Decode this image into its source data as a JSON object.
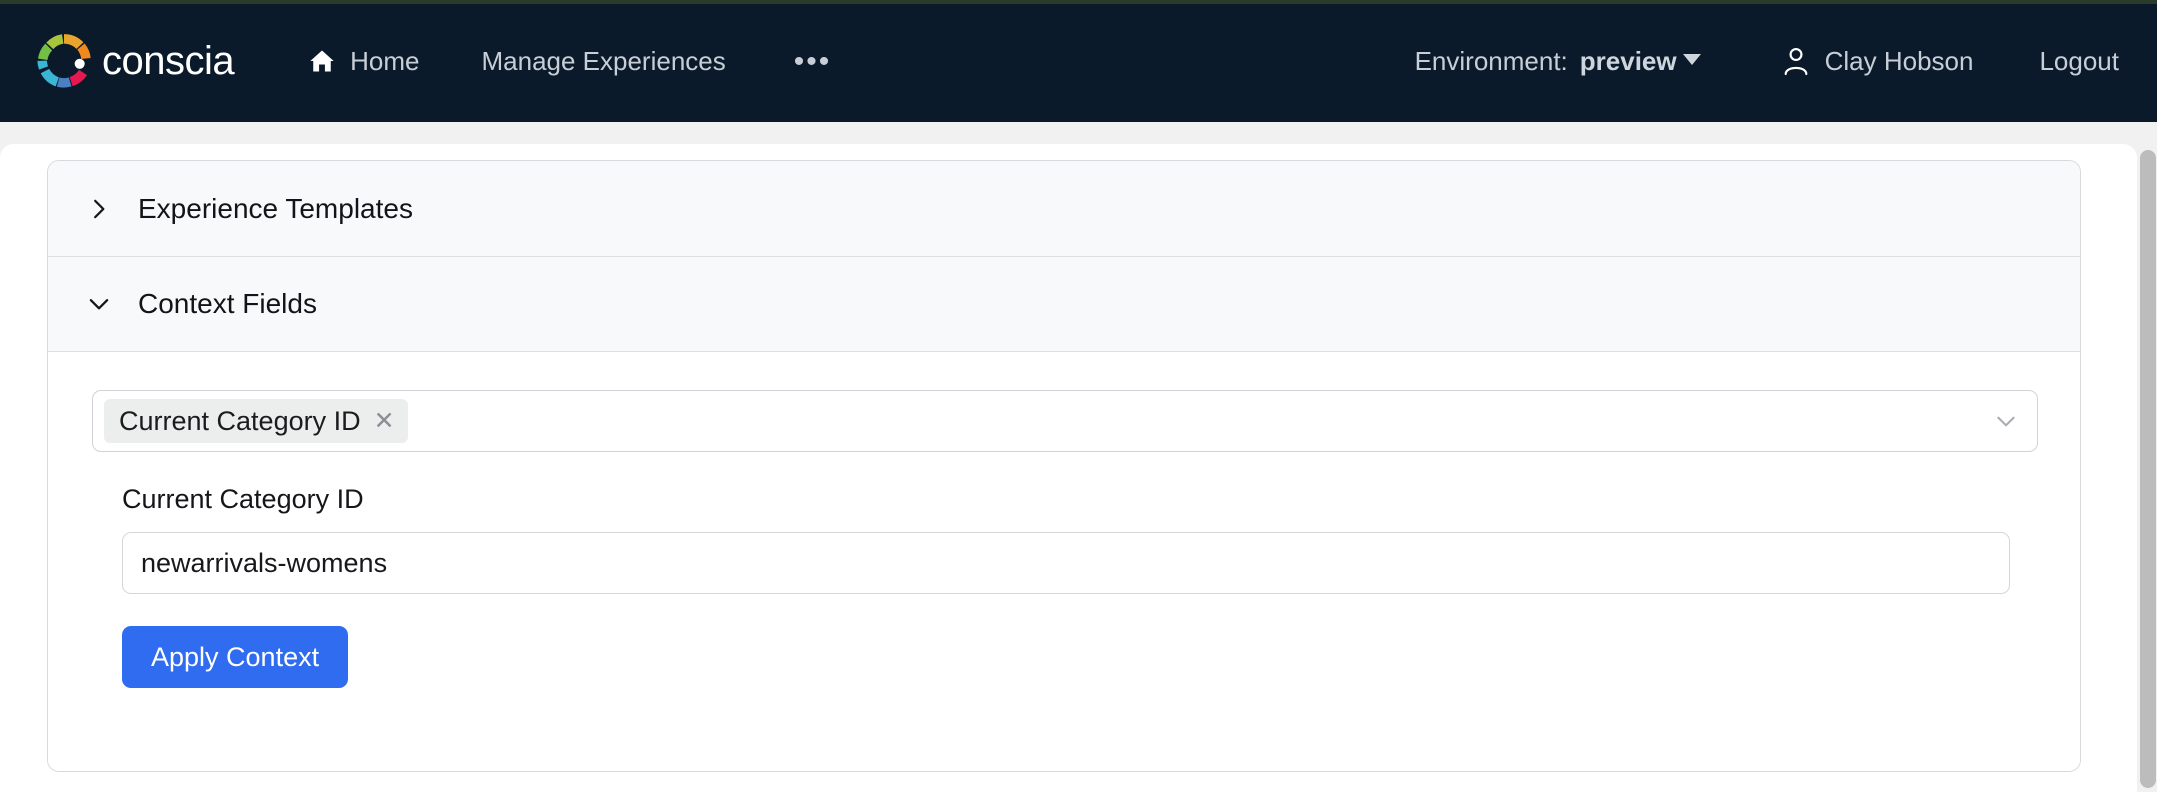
{
  "brand": {
    "name": "conscia",
    "logo_icon": "conscia-color-wheel-logo",
    "segment_colors": [
      "#f08a1e",
      "#eaa62c",
      "#a8c63c",
      "#72bf44",
      "#3ab6d4",
      "#4a7fc1",
      "#e8174f"
    ]
  },
  "nav": {
    "items": [
      {
        "label": "Home",
        "icon": "home-icon"
      },
      {
        "label": "Manage Experiences",
        "icon": null
      }
    ],
    "more_label": "•••"
  },
  "environment": {
    "label": "Environment:",
    "value": "preview",
    "caret_icon": "caret-down-icon"
  },
  "user": {
    "name": "Clay Hobson",
    "icon": "user-icon",
    "logout_label": "Logout"
  },
  "accordions": [
    {
      "title": "Experience Templates",
      "expanded": false,
      "chevron_icon": "chevron-right-icon"
    },
    {
      "title": "Context Fields",
      "expanded": true,
      "chevron_icon": "chevron-down-icon"
    }
  ],
  "context_fields": {
    "multiselect": {
      "selected_chip": "Current Category ID",
      "remove_icon": "close-x-icon",
      "dropdown_icon": "chevron-down-icon",
      "placeholder": ""
    },
    "field": {
      "label": "Current Category ID",
      "value": "newarrivals-womens",
      "placeholder": ""
    },
    "apply_button": "Apply Context"
  },
  "colors": {
    "topbar_background": "#0b1a2b",
    "primary_button": "#2f6cf0",
    "page_background": "#f1f1f1",
    "accordion_header": "#f8f9fa",
    "chip_background": "#eceded"
  },
  "scrollbar": {
    "name": "vertical-scrollbar"
  }
}
